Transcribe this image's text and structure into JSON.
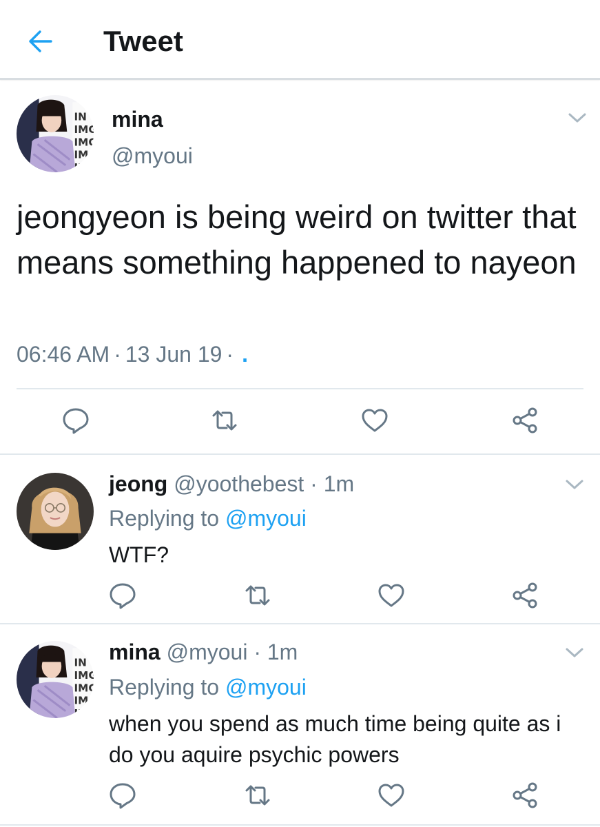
{
  "header": {
    "title": "Tweet",
    "back_icon": "arrow-left-icon"
  },
  "colors": {
    "accent": "#1da1f2",
    "secondary_text": "#657786",
    "primary_text": "#14171a",
    "divider": "#e1e8ed"
  },
  "main_tweet": {
    "name": "mina",
    "handle": "@myoui",
    "text": "jeongyeon is being weird on twitter that means something happened to nayeon",
    "time": "06:46 AM",
    "date": "13 Jun 19",
    "source_dot": "."
  },
  "replies": [
    {
      "name": "jeong",
      "handle": "@yoothebest",
      "time": "1m",
      "replying_prefix": "Replying to",
      "replying_to": "@myoui",
      "text": "WTF?"
    },
    {
      "name": "mina",
      "handle": "@myoui",
      "time": "1m",
      "replying_prefix": "Replying to",
      "replying_to": "@myoui",
      "text": "when you spend as much time being quite as i do you aquire psychic powers"
    }
  ],
  "actions": [
    "reply-icon",
    "retweet-icon",
    "like-icon",
    "share-icon"
  ]
}
